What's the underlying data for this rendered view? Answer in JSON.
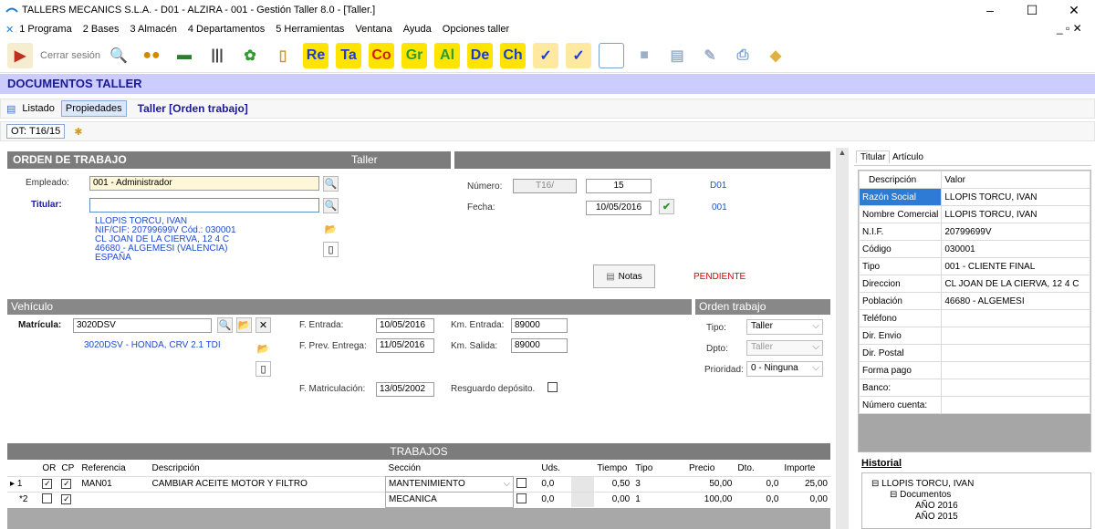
{
  "window": {
    "title": "TALLERS MECANICS S.L.A. - D01 - ALZIRA - 001 - Gestión Taller 8.0 - [Taller.]"
  },
  "menu": [
    "1 Programa",
    "2 Bases",
    "3 Almacén",
    "4 Departamentos",
    "5 Herramientas",
    "Ventana",
    "Ayuda",
    "Opciones taller"
  ],
  "toolbar": {
    "logout": "Cerrar sesión",
    "text_icons": [
      "Re",
      "Ta",
      "Co",
      "Gr",
      "Al",
      "De",
      "Ch"
    ]
  },
  "colors": {
    "header_bg": "#ccccff",
    "header_text": "#1a1a99",
    "section_bg": "#7c7c7c",
    "link_blue": "#1e4bd2",
    "pending": "#e00000"
  },
  "page": {
    "header": "DOCUMENTOS TALLER",
    "tab_listado": "Listado",
    "tab_propiedades": "Propiedades",
    "doc_title": "Taller [Orden trabajo]",
    "ot_tab": "OT: T16/15"
  },
  "orden": {
    "title": "ORDEN DE TRABAJO",
    "type": "Taller",
    "empleado_label": "Empleado:",
    "empleado": "001 - Administrador",
    "titular_label": "Titular:",
    "titular": "",
    "address": [
      "LLOPIS TORCU, IVAN",
      "NIF/CIF: 20799699V  Cód.: 030001",
      "CL JOAN DE LA CIERVA, 12 4 C",
      "46680 - ALGEMESI (VALENCIA)",
      "ESPAÑA"
    ],
    "numero_label": "Número:",
    "serie": "T16/",
    "numero": "15",
    "fecha_label": "Fecha:",
    "fecha": "10/05/2016",
    "d01": "D01",
    "code": "001",
    "notas": "Notas",
    "estado": "PENDIENTE"
  },
  "vehiculo": {
    "title": "Vehículo",
    "matricula_label": "Matrícula:",
    "matricula": "3020DSV",
    "desc": "3020DSV - HONDA, CRV 2.1 TDI",
    "f_entrada_label": "F. Entrada:",
    "f_entrada": "10/05/2016",
    "f_prev_label": "F. Prev. Entrega:",
    "f_prev": "11/05/2016",
    "f_matric_label": "F. Matriculación:",
    "f_matric": "13/05/2002",
    "km_entrada_label": "Km. Entrada:",
    "km_entrada": "89000",
    "km_salida_label": "Km. Salida:",
    "km_salida": "89000",
    "resguardo_label": "Resguardo depósito."
  },
  "orden_trabajo": {
    "title": "Orden trabajo",
    "tipo_label": "Tipo:",
    "tipo": "Taller",
    "dpto_label": "Dpto:",
    "dpto": "Taller",
    "prioridad_label": "Prioridad:",
    "prioridad": "0 - Ninguna"
  },
  "trabajos": {
    "title": "TRABAJOS",
    "columns": [
      "OR",
      "CP",
      "Referencia",
      "Descripción",
      "Sección",
      "Uds.",
      "Tiempo",
      "Tipo",
      "Precio",
      "Dto.",
      "Importe"
    ],
    "rows": [
      {
        "num": "1",
        "ref": "MAN01",
        "desc": "CAMBIAR ACEITE MOTOR Y FILTRO",
        "seccion": "MANTENIMIENTO",
        "uds": "0,0",
        "tiempo": "0,50",
        "tipo": "3",
        "precio": "50,00",
        "dto": "0,0",
        "importe": "25,00",
        "or": true,
        "cp": true
      },
      {
        "num": "*2",
        "ref": "",
        "desc": "",
        "seccion": "MECANICA",
        "uds": "0,0",
        "tiempo": "0,00",
        "tipo": "1",
        "precio": "100,00",
        "dto": "0,0",
        "importe": "0,00",
        "or": false,
        "cp": true
      }
    ]
  },
  "right_panel": {
    "tabs": [
      "Titular",
      "Artículo"
    ],
    "col_desc": "Descripción",
    "col_valor": "Valor",
    "rows": [
      {
        "k": "Razón Social",
        "v": "LLOPIS TORCU, IVAN"
      },
      {
        "k": "Nombre Comercial",
        "v": "LLOPIS TORCU, IVAN"
      },
      {
        "k": "N.I.F.",
        "v": "20799699V"
      },
      {
        "k": "Código",
        "v": "030001"
      },
      {
        "k": "Tipo",
        "v": "001 - CLIENTE FINAL"
      },
      {
        "k": "Direccion",
        "v": "CL JOAN DE LA CIERVA, 12 4 C"
      },
      {
        "k": "Población",
        "v": "46680 - ALGEMESI"
      },
      {
        "k": "Teléfono",
        "v": ""
      },
      {
        "k": "Dir. Envio",
        "v": ""
      },
      {
        "k": "Dir. Postal",
        "v": ""
      },
      {
        "k": "Forma pago",
        "v": ""
      },
      {
        "k": "Banco:",
        "v": ""
      },
      {
        "k": "Número cuenta:",
        "v": ""
      }
    ],
    "historial_title": "Historial",
    "tree": [
      "LLOPIS TORCU, IVAN",
      "Documentos",
      "AÑO 2016",
      "AÑO 2015"
    ]
  }
}
